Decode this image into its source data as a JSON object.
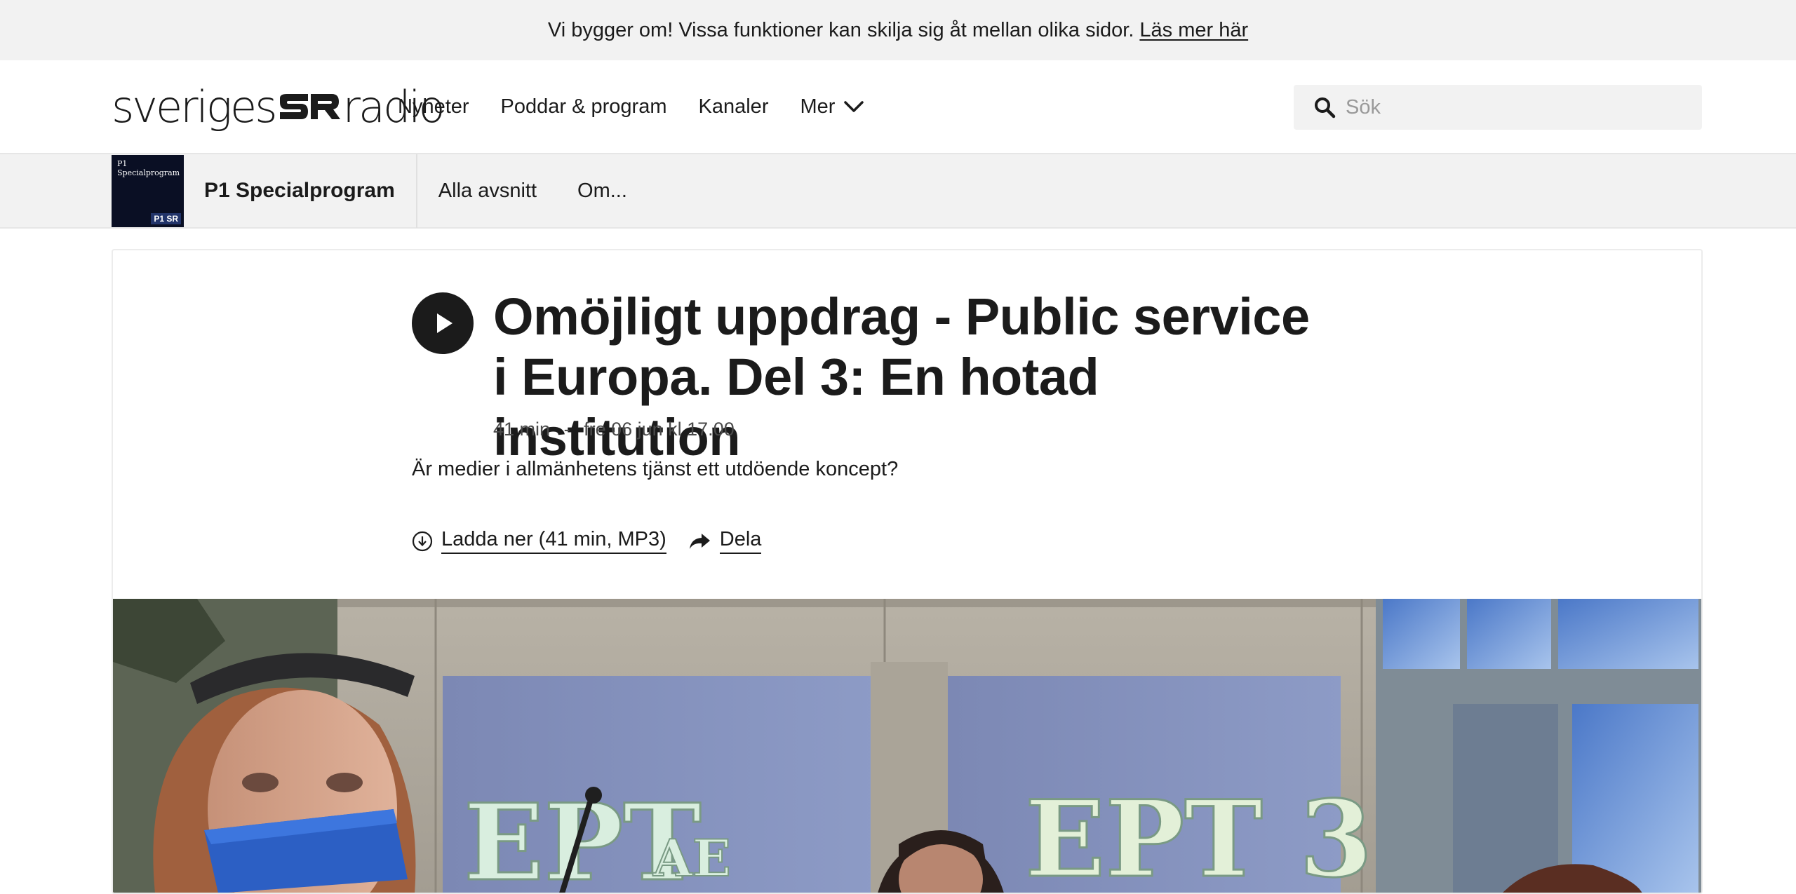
{
  "notice": {
    "text": "Vi bygger om! Vissa funktioner kan skilja sig åt mellan olika sidor.",
    "link_label": "Läs mer här"
  },
  "header": {
    "logo_left": "sveriges",
    "logo_right": "radio",
    "nav": [
      {
        "label": "Nyheter"
      },
      {
        "label": "Poddar & program"
      },
      {
        "label": "Kanaler"
      },
      {
        "label": "Mer"
      }
    ],
    "search_placeholder": "Sök"
  },
  "program": {
    "thumb_title": "P1 Specialprogram",
    "thumb_badge": "P1 SR",
    "name": "P1 Specialprogram",
    "tabs": [
      {
        "label": "Alla avsnitt"
      },
      {
        "label": "Om..."
      }
    ]
  },
  "episode": {
    "title": "Omöjligt uppdrag - Public service i Europa. Del 3: En hotad institution",
    "duration": "41 min",
    "separator": "-",
    "date": "fre 06 jun kl 17.00",
    "description": "Är medier i allmänhetens tjänst ett utdöende koncept?",
    "download_label": "Ladda ner (41 min, MP3)",
    "share_label": "Dela"
  },
  "image": {
    "sign_left": "EPT",
    "sign_left_small": "AE",
    "sign_right": "EPT 3"
  },
  "colors": {
    "ink": "#1b1b1b",
    "bar_bg": "#f2f2f2"
  }
}
